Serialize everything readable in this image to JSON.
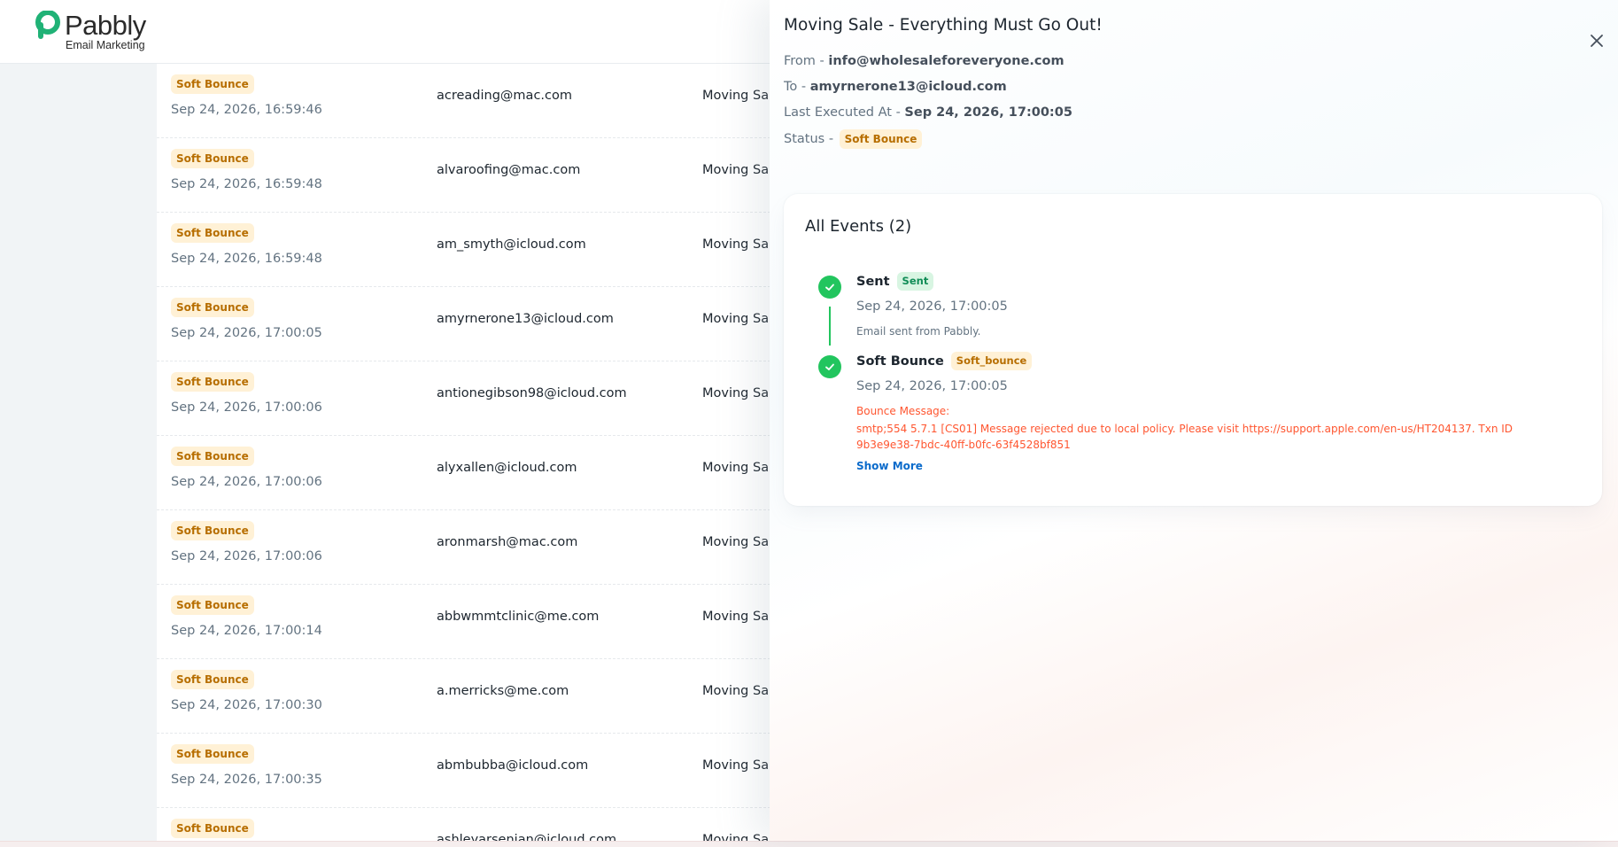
{
  "app": {
    "logo_word": "Pabbly",
    "logo_sub": "Email Marketing"
  },
  "table": {
    "rows": [
      {
        "status": "Soft Bounce",
        "date": "Sep 24, 2026, 16:59:46",
        "email": "acreading@mac.com",
        "subject": "Moving Sale"
      },
      {
        "status": "Soft Bounce",
        "date": "Sep 24, 2026, 16:59:48",
        "email": "alvaroofing@mac.com",
        "subject": "Moving Sale"
      },
      {
        "status": "Soft Bounce",
        "date": "Sep 24, 2026, 16:59:48",
        "email": "am_smyth@icloud.com",
        "subject": "Moving Sale"
      },
      {
        "status": "Soft Bounce",
        "date": "Sep 24, 2026, 17:00:05",
        "email": "amyrnerone13@icloud.com",
        "subject": "Moving Sale"
      },
      {
        "status": "Soft Bounce",
        "date": "Sep 24, 2026, 17:00:06",
        "email": "antionegibson98@icloud.com",
        "subject": "Moving Sale"
      },
      {
        "status": "Soft Bounce",
        "date": "Sep 24, 2026, 17:00:06",
        "email": "alyxallen@icloud.com",
        "subject": "Moving Sale"
      },
      {
        "status": "Soft Bounce",
        "date": "Sep 24, 2026, 17:00:06",
        "email": "aronmarsh@mac.com",
        "subject": "Moving Sale"
      },
      {
        "status": "Soft Bounce",
        "date": "Sep 24, 2026, 17:00:14",
        "email": "abbwmmtclinic@me.com",
        "subject": "Moving Sale"
      },
      {
        "status": "Soft Bounce",
        "date": "Sep 24, 2026, 17:00:30",
        "email": "a.merricks@me.com",
        "subject": "Moving Sale"
      },
      {
        "status": "Soft Bounce",
        "date": "Sep 24, 2026, 17:00:35",
        "email": "abmbubba@icloud.com",
        "subject": "Moving Sale"
      },
      {
        "status": "Soft Bounce",
        "date": "",
        "email": "ashleyarsenian@icloud.com",
        "subject": "Moving Sale"
      }
    ]
  },
  "drawer": {
    "title": "Moving Sale - Everything Must Go Out!",
    "from_label": "From - ",
    "from_value": "info@wholesaleforeveryone.com",
    "to_label": "To - ",
    "to_value": "amyrnerone13@icloud.com",
    "executed_label": "Last Executed At - ",
    "executed_value": "Sep 24, 2026, 17:00:05",
    "status_label": "Status - ",
    "status_value": "Soft Bounce",
    "events_title": "All Events (2)",
    "events": [
      {
        "title": "Sent",
        "badge": "Sent",
        "date": "Sep 24, 2026, 17:00:05",
        "desc": "Email sent from Pabbly."
      },
      {
        "title": "Soft Bounce",
        "badge": "Soft_bounce",
        "date": "Sep 24, 2026, 17:00:05",
        "bounce_label": "Bounce Message:",
        "bounce_message": "smtp;554 5.7.1 [CS01] Message rejected due to local policy. Please visit https://support.apple.com/en-us/HT204137. Txn ID 9b3e9e38-7bdc-40ff-b0fc-63f4528bf851",
        "show_more": "Show More"
      }
    ]
  },
  "colors": {
    "success": "#22c55e",
    "warning_bg": "#fff1d6",
    "warning_text": "#b76e00",
    "error": "#ff5630",
    "link": "#0b6bcb"
  }
}
